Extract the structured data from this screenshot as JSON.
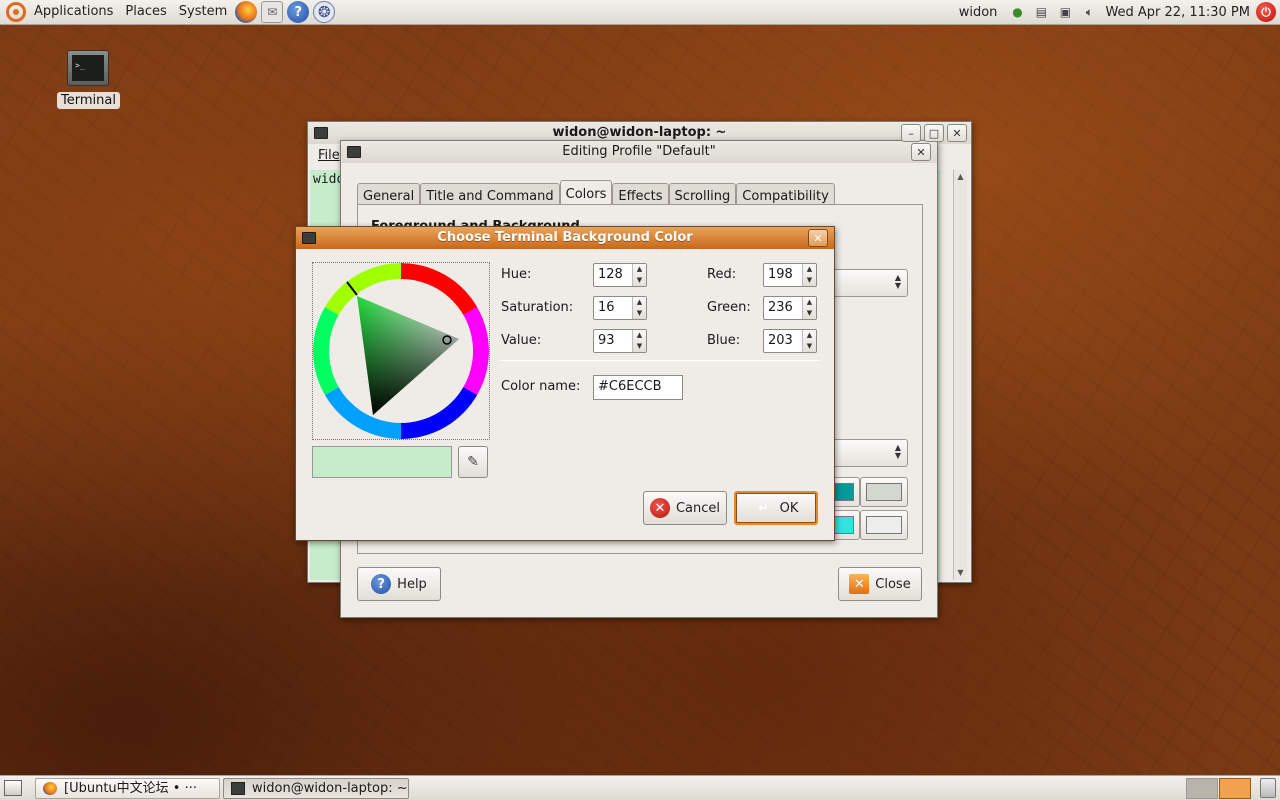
{
  "top_panel": {
    "menus": [
      "Applications",
      "Places",
      "System"
    ],
    "launchers": [
      "firefox-icon",
      "mail-icon",
      "help-icon",
      "gear-icon"
    ],
    "user": "widon",
    "clock": "Wed Apr 22, 11:30 PM"
  },
  "desktop": {
    "terminal_label": "Terminal",
    "terminal_prompt": ">_"
  },
  "terminal_window": {
    "title": "widon@widon-laptop: ~",
    "menu_file": "File",
    "prompt_fragment": "wido"
  },
  "profile_window": {
    "title": "Editing Profile \"Default\"",
    "tabs": [
      "General",
      "Title and Command",
      "Colors",
      "Effects",
      "Scrolling",
      "Compatibility"
    ],
    "active_tab": "Colors",
    "section_heading": "Foreground and Background",
    "help_label": "Help",
    "close_label": "Close",
    "palette_colors": [
      "#06989a",
      "#d3d7cf",
      "#34e2e2",
      "#eeeeec"
    ]
  },
  "color_dialog": {
    "title": "Choose Terminal Background Color",
    "hue_label": "Hue:",
    "hue": "128",
    "saturation_label": "Saturation:",
    "saturation": "16",
    "value_label": "Value:",
    "value": "93",
    "red_label": "Red:",
    "red": "198",
    "green_label": "Green:",
    "green": "236",
    "blue_label": "Blue:",
    "blue": "203",
    "color_name_label": "Color name:",
    "color_name": "#C6ECCB",
    "preview_color": "#c6eccb",
    "cancel_label": "Cancel",
    "ok_label": "OK"
  },
  "bottom_panel": {
    "tasks": [
      "[Ubuntu中文论坛 • ···",
      "widon@widon-laptop: ~"
    ]
  }
}
